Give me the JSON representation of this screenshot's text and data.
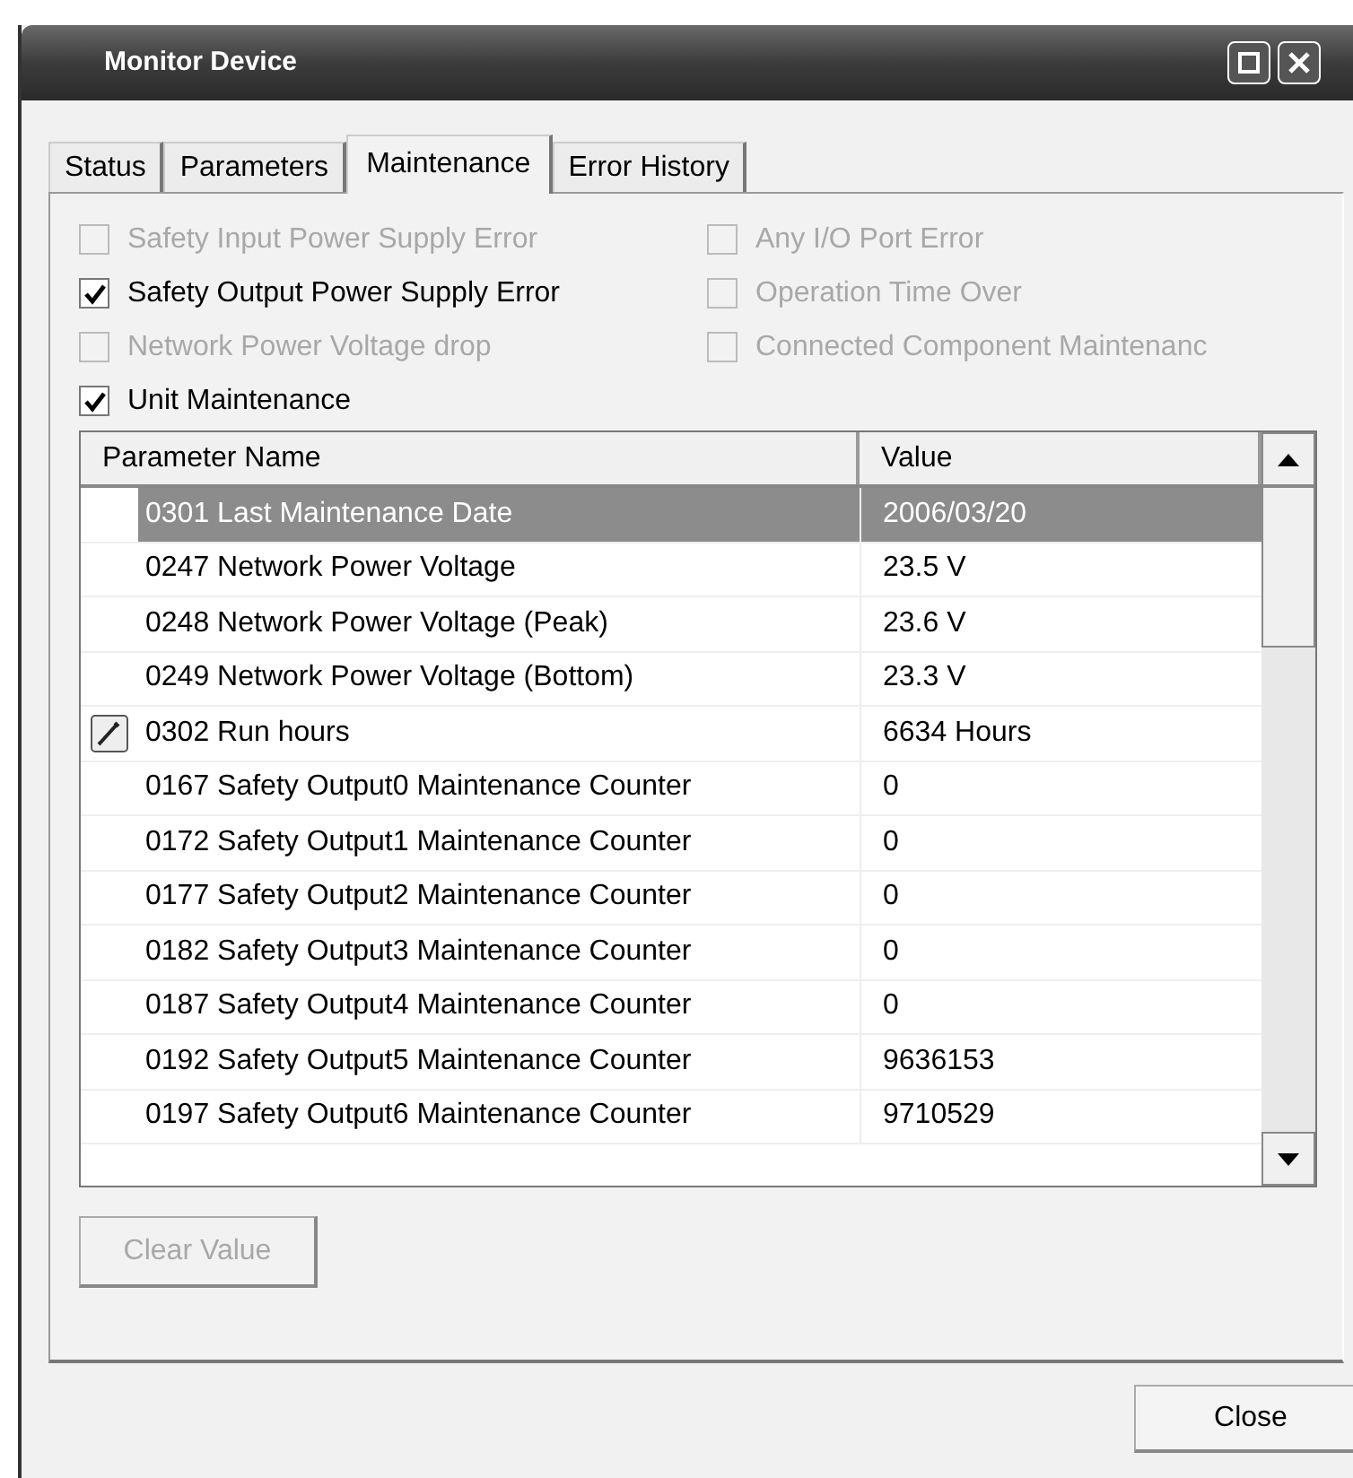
{
  "window": {
    "title": "Monitor Device"
  },
  "tabs": [
    {
      "label": "Status",
      "selected": false
    },
    {
      "label": "Parameters",
      "selected": false
    },
    {
      "label": "Maintenance",
      "selected": true
    },
    {
      "label": "Error History",
      "selected": false
    }
  ],
  "options": [
    {
      "label": "Safety Input Power Supply Error",
      "checked": false,
      "disabled": true
    },
    {
      "label": "Any I/O Port Error",
      "checked": false,
      "disabled": true
    },
    {
      "label": "Safety Output Power Supply Error",
      "checked": true,
      "disabled": false
    },
    {
      "label": "Operation Time Over",
      "checked": false,
      "disabled": true
    },
    {
      "label": "Network Power Voltage drop",
      "checked": false,
      "disabled": true
    },
    {
      "label": "Connected Component Maintenanc",
      "checked": false,
      "disabled": true
    },
    {
      "label": "Unit Maintenance",
      "checked": true,
      "disabled": false
    }
  ],
  "table": {
    "columns": [
      "Parameter Name",
      "Value"
    ],
    "rows": [
      {
        "name": "0301 Last Maintenance Date",
        "value": "2006/03/20",
        "selected": true,
        "editable": false
      },
      {
        "name": "0247 Network Power Voltage",
        "value": "23.5 V",
        "selected": false,
        "editable": false
      },
      {
        "name": "0248 Network Power Voltage (Peak)",
        "value": "23.6 V",
        "selected": false,
        "editable": false
      },
      {
        "name": "0249 Network Power Voltage (Bottom)",
        "value": "23.3 V",
        "selected": false,
        "editable": false
      },
      {
        "name": "0302 Run hours",
        "value": "6634 Hours",
        "selected": false,
        "editable": true
      },
      {
        "name": "0167 Safety Output0 Maintenance Counter",
        "value": "0",
        "selected": false,
        "editable": false
      },
      {
        "name": "0172 Safety Output1 Maintenance Counter",
        "value": "0",
        "selected": false,
        "editable": false
      },
      {
        "name": "0177 Safety Output2 Maintenance Counter",
        "value": "0",
        "selected": false,
        "editable": false
      },
      {
        "name": "0182 Safety Output3 Maintenance Counter",
        "value": "0",
        "selected": false,
        "editable": false
      },
      {
        "name": "0187 Safety Output4 Maintenance Counter",
        "value": "0",
        "selected": false,
        "editable": false
      },
      {
        "name": "0192 Safety Output5 Maintenance Counter",
        "value": "9636153",
        "selected": false,
        "editable": false
      },
      {
        "name": "0197 Safety Output6 Maintenance Counter",
        "value": "9710529",
        "selected": false,
        "editable": false
      }
    ]
  },
  "buttons": [
    {
      "label": "Clear Value",
      "disabled": true
    },
    {
      "label": "Close",
      "disabled": false
    }
  ]
}
